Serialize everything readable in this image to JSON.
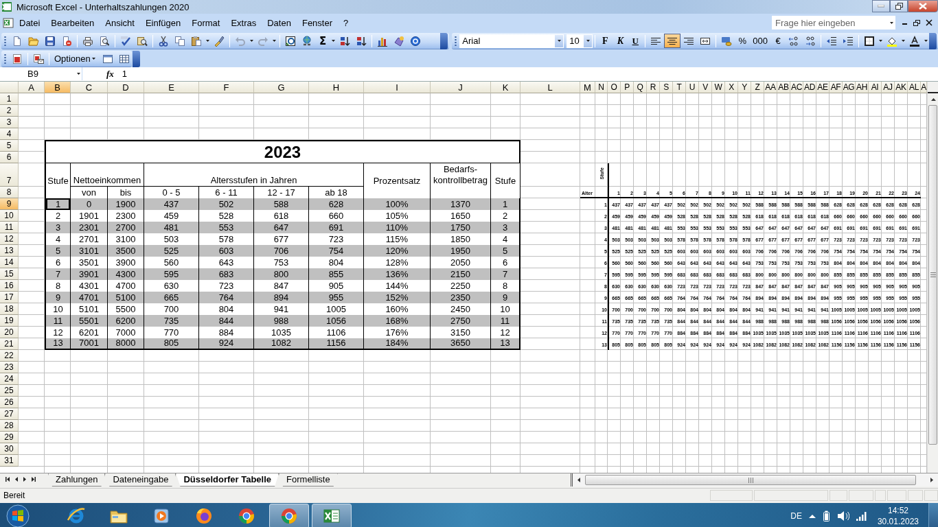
{
  "window": {
    "title": "Microsoft Excel - Unterhaltszahlungen 2020"
  },
  "menu": {
    "items": [
      "Datei",
      "Bearbeiten",
      "Ansicht",
      "Einfügen",
      "Format",
      "Extras",
      "Daten",
      "Fenster",
      "?"
    ],
    "help_box": {
      "placeholder": "Frage hier eingeben"
    }
  },
  "standard_toolbar": {
    "buttons": [
      {
        "kind": "new"
      },
      {
        "kind": "open"
      },
      {
        "kind": "save"
      },
      {
        "kind": "permission"
      },
      {
        "kind": "separator"
      },
      {
        "kind": "print"
      },
      {
        "kind": "preview"
      },
      {
        "kind": "separator"
      },
      {
        "kind": "spelling"
      },
      {
        "kind": "research"
      },
      {
        "kind": "separator"
      },
      {
        "kind": "cut"
      },
      {
        "kind": "copy"
      },
      {
        "kind": "paste"
      },
      {
        "kind": "brush"
      },
      {
        "kind": "separator"
      },
      {
        "kind": "undo"
      },
      {
        "kind": "redo"
      },
      {
        "kind": "separator"
      },
      {
        "kind": "euro"
      },
      {
        "kind": "link"
      },
      {
        "kind": "sum",
        "label": "Σ"
      },
      {
        "kind": "sort-asc"
      },
      {
        "kind": "sort-desc"
      },
      {
        "kind": "separator"
      },
      {
        "kind": "chart"
      },
      {
        "kind": "drawing"
      },
      {
        "kind": "help"
      }
    ]
  },
  "format_toolbar": {
    "font": "Arial",
    "size": "10",
    "buttons": [
      {
        "kind": "bold",
        "label": "F",
        "selected": false
      },
      {
        "kind": "italic",
        "label": "K",
        "selected": false
      },
      {
        "kind": "underline",
        "label": "U",
        "selected": false
      },
      {
        "kind": "separator"
      },
      {
        "kind": "align-left",
        "selected": false
      },
      {
        "kind": "align-center",
        "selected": true
      },
      {
        "kind": "align-right",
        "selected": false
      },
      {
        "kind": "merge",
        "selected": false
      },
      {
        "kind": "separator"
      },
      {
        "kind": "currency-style"
      },
      {
        "kind": "text",
        "label": "%"
      },
      {
        "kind": "text",
        "label": "000"
      },
      {
        "kind": "text",
        "label": "€"
      },
      {
        "kind": "inc-decimal"
      },
      {
        "kind": "dec-decimal"
      },
      {
        "kind": "separator"
      },
      {
        "kind": "outdent"
      },
      {
        "kind": "indent"
      },
      {
        "kind": "separator"
      },
      {
        "kind": "borders"
      },
      {
        "kind": "fill-color"
      },
      {
        "kind": "font-color"
      }
    ]
  },
  "pdf_toolbar": {
    "buttons": [
      {
        "kind": "pdf"
      },
      {
        "kind": "separator"
      },
      {
        "kind": "pdf-mail"
      },
      {
        "kind": "separator"
      },
      {
        "kind": "menu",
        "label": "Optionen"
      },
      {
        "kind": "frame"
      },
      {
        "kind": "table"
      }
    ]
  },
  "formula_bar": {
    "name_box": "B9",
    "function_label": "fx",
    "value": "1"
  },
  "sheet": {
    "columns": [
      {
        "label": "A",
        "selected": false
      },
      {
        "label": "B",
        "selected": true
      },
      {
        "label": "C",
        "selected": false
      },
      {
        "label": "D",
        "selected": false
      },
      {
        "label": "E",
        "selected": false
      },
      {
        "label": "F",
        "selected": false
      },
      {
        "label": "G",
        "selected": false
      },
      {
        "label": "H",
        "selected": false
      },
      {
        "label": "I",
        "selected": false
      },
      {
        "label": "J",
        "selected": false
      },
      {
        "label": "K",
        "selected": false
      },
      {
        "label": "L",
        "selected": false
      },
      {
        "label": "M",
        "selected": false
      },
      {
        "label": "N",
        "selected": false
      },
      {
        "label": "O",
        "selected": false
      },
      {
        "label": "P",
        "selected": false
      },
      {
        "label": "Q",
        "selected": false
      },
      {
        "label": "R",
        "selected": false
      },
      {
        "label": "S",
        "selected": false
      },
      {
        "label": "T",
        "selected": false
      },
      {
        "label": "U",
        "selected": false
      },
      {
        "label": "V",
        "selected": false
      },
      {
        "label": "W",
        "selected": false
      },
      {
        "label": "X",
        "selected": false
      },
      {
        "label": "Y",
        "selected": false
      },
      {
        "label": "Z",
        "selected": false
      },
      {
        "label": "AA",
        "selected": false
      },
      {
        "label": "AB",
        "selected": false
      },
      {
        "label": "AC",
        "selected": false
      },
      {
        "label": "AD",
        "selected": false
      },
      {
        "label": "AE",
        "selected": false
      },
      {
        "label": "AF",
        "selected": false
      },
      {
        "label": "AG",
        "selected": false
      },
      {
        "label": "AH",
        "selected": false
      },
      {
        "label": "AI",
        "selected": false
      },
      {
        "label": "AJ",
        "selected": false
      },
      {
        "label": "AK",
        "selected": false
      },
      {
        "label": "AL",
        "selected": false
      },
      {
        "label": "A",
        "selected": false
      }
    ],
    "rows": [
      {
        "label": "1",
        "selected": false
      },
      {
        "label": "2",
        "selected": false
      },
      {
        "label": "3",
        "selected": false
      },
      {
        "label": "4",
        "selected": false
      },
      {
        "label": "5",
        "selected": false
      },
      {
        "label": "6",
        "selected": false
      },
      {
        "label": "7",
        "selected": false
      },
      {
        "label": "8",
        "selected": false
      },
      {
        "label": "9",
        "selected": true
      },
      {
        "label": "10",
        "selected": false
      },
      {
        "label": "11",
        "selected": false
      },
      {
        "label": "12",
        "selected": false
      },
      {
        "label": "13",
        "selected": false
      },
      {
        "label": "14",
        "selected": false
      },
      {
        "label": "15",
        "selected": false
      },
      {
        "label": "16",
        "selected": false
      },
      {
        "label": "17",
        "selected": false
      },
      {
        "label": "18",
        "selected": false
      },
      {
        "label": "19",
        "selected": false
      },
      {
        "label": "20",
        "selected": false
      },
      {
        "label": "21",
        "selected": false
      },
      {
        "label": "22",
        "selected": false
      },
      {
        "label": "23",
        "selected": false
      },
      {
        "label": "24",
        "selected": false
      },
      {
        "label": "25",
        "selected": false
      },
      {
        "label": "26",
        "selected": false
      },
      {
        "label": "27",
        "selected": false
      },
      {
        "label": "28",
        "selected": false
      },
      {
        "label": "29",
        "selected": false
      },
      {
        "label": "30",
        "selected": false
      },
      {
        "label": "31",
        "selected": false
      }
    ],
    "table": {
      "title": "2023",
      "header": [
        "Stufe",
        "Nettoeinkommen",
        "Altersstufen in Jahren",
        "Prozentsatz",
        "Bedarfs-\nkontrollbetrag",
        "Stufe"
      ],
      "subheader": [
        "von",
        "bis",
        "0 - 5",
        "6 - 11",
        "12 - 17",
        "ab 18"
      ],
      "rows": [
        {
          "shaded": true,
          "cells": [
            "1",
            "0",
            "1900",
            "437",
            "502",
            "588",
            "628",
            "100%",
            "1370",
            "1"
          ]
        },
        {
          "shaded": false,
          "cells": [
            "2",
            "1901",
            "2300",
            "459",
            "528",
            "618",
            "660",
            "105%",
            "1650",
            "2"
          ]
        },
        {
          "shaded": true,
          "cells": [
            "3",
            "2301",
            "2700",
            "481",
            "553",
            "647",
            "691",
            "110%",
            "1750",
            "3"
          ]
        },
        {
          "shaded": false,
          "cells": [
            "4",
            "2701",
            "3100",
            "503",
            "578",
            "677",
            "723",
            "115%",
            "1850",
            "4"
          ]
        },
        {
          "shaded": true,
          "cells": [
            "5",
            "3101",
            "3500",
            "525",
            "603",
            "706",
            "754",
            "120%",
            "1950",
            "5"
          ]
        },
        {
          "shaded": false,
          "cells": [
            "6",
            "3501",
            "3900",
            "560",
            "643",
            "753",
            "804",
            "128%",
            "2050",
            "6"
          ]
        },
        {
          "shaded": true,
          "cells": [
            "7",
            "3901",
            "4300",
            "595",
            "683",
            "800",
            "855",
            "136%",
            "2150",
            "7"
          ]
        },
        {
          "shaded": false,
          "cells": [
            "8",
            "4301",
            "4700",
            "630",
            "723",
            "847",
            "905",
            "144%",
            "2250",
            "8"
          ]
        },
        {
          "shaded": true,
          "cells": [
            "9",
            "4701",
            "5100",
            "665",
            "764",
            "894",
            "955",
            "152%",
            "2350",
            "9"
          ]
        },
        {
          "shaded": false,
          "cells": [
            "10",
            "5101",
            "5500",
            "700",
            "804",
            "941",
            "1005",
            "160%",
            "2450",
            "10"
          ]
        },
        {
          "shaded": true,
          "cells": [
            "11",
            "5501",
            "6200",
            "735",
            "844",
            "988",
            "1056",
            "168%",
            "2750",
            "11"
          ]
        },
        {
          "shaded": false,
          "cells": [
            "12",
            "6201",
            "7000",
            "770",
            "884",
            "1035",
            "1106",
            "176%",
            "3150",
            "12"
          ]
        },
        {
          "shaded": true,
          "cells": [
            "13",
            "7001",
            "8000",
            "805",
            "924",
            "1082",
            "1156",
            "184%",
            "3650",
            "13"
          ]
        }
      ]
    },
    "matrix": {
      "row_label": "Stufe",
      "column_label": "Alter",
      "columns": [
        "1",
        "2",
        "3",
        "4",
        "5",
        "6",
        "7",
        "8",
        "9",
        "10",
        "11",
        "12",
        "13",
        "14",
        "15",
        "16",
        "17",
        "18",
        "19",
        "20",
        "21",
        "22",
        "23",
        "24"
      ],
      "rows": [
        {
          "label": "1",
          "values": [
            "437",
            "437",
            "437",
            "437",
            "437",
            "502",
            "502",
            "502",
            "502",
            "502",
            "502",
            "588",
            "588",
            "588",
            "588",
            "588",
            "588",
            "628",
            "628",
            "628",
            "628",
            "628",
            "628",
            "628"
          ]
        },
        {
          "label": "2",
          "values": [
            "459",
            "459",
            "459",
            "459",
            "459",
            "528",
            "528",
            "528",
            "528",
            "528",
            "528",
            "618",
            "618",
            "618",
            "618",
            "618",
            "618",
            "660",
            "660",
            "660",
            "660",
            "660",
            "660",
            "660"
          ]
        },
        {
          "label": "3",
          "values": [
            "481",
            "481",
            "481",
            "481",
            "481",
            "553",
            "553",
            "553",
            "553",
            "553",
            "553",
            "647",
            "647",
            "647",
            "647",
            "647",
            "647",
            "691",
            "691",
            "691",
            "691",
            "691",
            "691",
            "691"
          ]
        },
        {
          "label": "4",
          "values": [
            "503",
            "503",
            "503",
            "503",
            "503",
            "578",
            "578",
            "578",
            "578",
            "578",
            "578",
            "677",
            "677",
            "677",
            "677",
            "677",
            "677",
            "723",
            "723",
            "723",
            "723",
            "723",
            "723",
            "723"
          ]
        },
        {
          "label": "5",
          "values": [
            "525",
            "525",
            "525",
            "525",
            "525",
            "603",
            "603",
            "603",
            "603",
            "603",
            "603",
            "706",
            "706",
            "706",
            "706",
            "706",
            "706",
            "754",
            "754",
            "754",
            "754",
            "754",
            "754",
            "754"
          ]
        },
        {
          "label": "6",
          "values": [
            "560",
            "560",
            "560",
            "560",
            "560",
            "643",
            "643",
            "643",
            "643",
            "643",
            "643",
            "753",
            "753",
            "753",
            "753",
            "753",
            "753",
            "804",
            "804",
            "804",
            "804",
            "804",
            "804",
            "804"
          ]
        },
        {
          "label": "7",
          "values": [
            "595",
            "595",
            "595",
            "595",
            "595",
            "683",
            "683",
            "683",
            "683",
            "683",
            "683",
            "800",
            "800",
            "800",
            "800",
            "800",
            "800",
            "855",
            "855",
            "855",
            "855",
            "855",
            "855",
            "855"
          ]
        },
        {
          "label": "8",
          "values": [
            "630",
            "630",
            "630",
            "630",
            "630",
            "723",
            "723",
            "723",
            "723",
            "723",
            "723",
            "847",
            "847",
            "847",
            "847",
            "847",
            "847",
            "905",
            "905",
            "905",
            "905",
            "905",
            "905",
            "905"
          ]
        },
        {
          "label": "9",
          "values": [
            "665",
            "665",
            "665",
            "665",
            "665",
            "764",
            "764",
            "764",
            "764",
            "764",
            "764",
            "894",
            "894",
            "894",
            "894",
            "894",
            "894",
            "955",
            "955",
            "955",
            "955",
            "955",
            "955",
            "955"
          ]
        },
        {
          "label": "10",
          "values": [
            "700",
            "700",
            "700",
            "700",
            "700",
            "804",
            "804",
            "804",
            "804",
            "804",
            "804",
            "941",
            "941",
            "941",
            "941",
            "941",
            "941",
            "1005",
            "1005",
            "1005",
            "1005",
            "1005",
            "1005",
            "1005"
          ]
        },
        {
          "label": "11",
          "values": [
            "735",
            "735",
            "735",
            "735",
            "735",
            "844",
            "844",
            "844",
            "844",
            "844",
            "844",
            "988",
            "988",
            "988",
            "988",
            "988",
            "988",
            "1056",
            "1056",
            "1056",
            "1056",
            "1056",
            "1056",
            "1056"
          ]
        },
        {
          "label": "12",
          "values": [
            "770",
            "770",
            "770",
            "770",
            "770",
            "884",
            "884",
            "884",
            "884",
            "884",
            "884",
            "1035",
            "1035",
            "1035",
            "1035",
            "1035",
            "1035",
            "1106",
            "1106",
            "1106",
            "1106",
            "1106",
            "1106",
            "1106"
          ]
        },
        {
          "label": "13",
          "values": [
            "805",
            "805",
            "805",
            "805",
            "805",
            "924",
            "924",
            "924",
            "924",
            "924",
            "924",
            "1082",
            "1082",
            "1082",
            "1082",
            "1082",
            "1082",
            "1156",
            "1156",
            "1156",
            "1156",
            "1156",
            "1156",
            "1156"
          ]
        }
      ]
    }
  },
  "sheet_tabs": [
    {
      "label": "Zahlungen",
      "selected": false
    },
    {
      "label": "Dateneingabe",
      "selected": false
    },
    {
      "label": "Düsseldorfer Tabelle",
      "selected": true
    },
    {
      "label": "Formelliste",
      "selected": false
    }
  ],
  "status_bar": {
    "text": "Bereit"
  },
  "taskbar": {
    "apps": [
      {
        "kind": "ie",
        "active": false
      },
      {
        "kind": "folder",
        "active": false
      },
      {
        "kind": "media",
        "active": false
      },
      {
        "kind": "firefox",
        "active": false
      },
      {
        "kind": "chrome",
        "active": false
      },
      {
        "kind": "chrome",
        "active": true
      },
      {
        "kind": "excel",
        "active": true
      }
    ],
    "tray": {
      "language": "DE",
      "time": "14:52",
      "date": "30.01.2023"
    }
  }
}
